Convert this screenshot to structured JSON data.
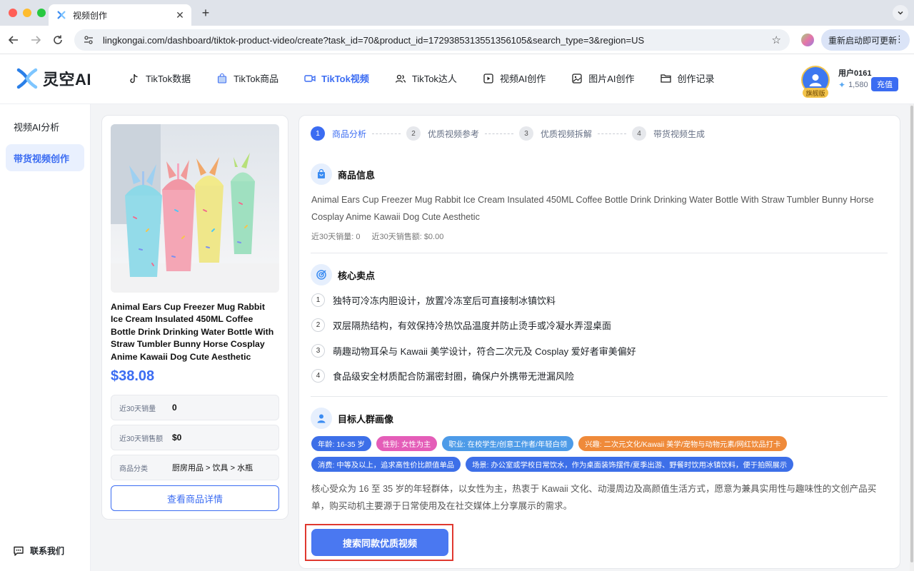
{
  "browser": {
    "tab_title": "视频创作",
    "new_tab": "+",
    "tab_close": "✕",
    "url": "lingkongai.com/dashboard/tiktok-product-video/create?task_id=70&product_id=1729385313551356105&search_type=3&region=US",
    "update_label": "重新启动即可更新",
    "update_menu": "⋮"
  },
  "header": {
    "logo_text": "灵空AI",
    "nav": [
      {
        "label": "TikTok数据",
        "icon": "tiktok-icon"
      },
      {
        "label": "TikTok商品",
        "icon": "bag-icon"
      },
      {
        "label": "TikTok视频",
        "icon": "video-icon"
      },
      {
        "label": "TikTok达人",
        "icon": "people-icon"
      },
      {
        "label": "视频AI创作",
        "icon": "play-icon"
      },
      {
        "label": "图片AI创作",
        "icon": "image-icon"
      },
      {
        "label": "创作记录",
        "icon": "folder-icon"
      }
    ],
    "user": {
      "name": "用户0161",
      "badge": "旗舰版",
      "credits": "1,580",
      "recharge": "充值"
    },
    "accent": "#3b6cf2"
  },
  "sidebar": {
    "items": [
      {
        "label": "视频AI分析"
      },
      {
        "label": "带货视频创作"
      }
    ],
    "contact": "联系我们"
  },
  "product": {
    "title": "Animal Ears Cup Freezer Mug Rabbit Ice Cream Insulated 450ML Coffee Bottle Drink Drinking Water Bottle With Straw Tumbler Bunny Horse Cosplay Anime Kawaii Dog Cute Aesthetic",
    "price": "$38.08",
    "stats": [
      {
        "key": "近30天销量",
        "value": "0"
      },
      {
        "key": "近30天销售额",
        "value": "$0"
      },
      {
        "key": "商品分类",
        "value": "厨房用品 > 饮具 > 水瓶"
      }
    ],
    "detail_button": "查看商品详情"
  },
  "steps": [
    {
      "num": "1",
      "label": "商品分析"
    },
    {
      "num": "2",
      "label": "优质视频参考"
    },
    {
      "num": "3",
      "label": "优质视频拆解"
    },
    {
      "num": "4",
      "label": "带货视频生成"
    }
  ],
  "info": {
    "heading": "商品信息",
    "text": "Animal Ears Cup Freezer Mug Rabbit Ice Cream Insulated 450ML Coffee Bottle Drink Drinking Water Bottle With Straw Tumbler Bunny Horse Cosplay Anime Kawaii Dog Cute Aesthetic",
    "sales_30d": "近30天销量: 0",
    "revenue_30d": "近30天销售额: $0.00"
  },
  "selling_points": {
    "heading": "核心卖点",
    "items": [
      {
        "num": "1",
        "text": "独特可冷冻内胆设计，放置冷冻室后可直接制冰镇饮料"
      },
      {
        "num": "2",
        "text": "双层隔热结构，有效保持冷热饮品温度并防止烫手或冷凝水弄湿桌面"
      },
      {
        "num": "3",
        "text": "萌趣动物耳朵与 Kawaii 美学设计，符合二次元及 Cosplay 爱好者审美偏好"
      },
      {
        "num": "4",
        "text": "食品级安全材质配合防漏密封圈，确保户外携带无泄漏风险"
      }
    ]
  },
  "audience": {
    "heading": "目标人群画像",
    "tags": [
      {
        "text": "年龄: 16-35 岁",
        "color": "#3d6fe8"
      },
      {
        "text": "性别: 女性为主",
        "color": "#e45db8"
      },
      {
        "text": "职业: 在校学生/创意工作者/年轻白领",
        "color": "#4d9be8"
      },
      {
        "text": "兴趣: 二次元文化/Kawaii 美学/宠物与动物元素/网红饮品打卡",
        "color": "#ef8a3a"
      },
      {
        "text": "消费: 中等及以上，追求高性价比颜值单品",
        "color": "#3d6fe8"
      },
      {
        "text": "场景: 办公室或学校日常饮水，作为桌面装饰摆件/夏季出游、野餐时饮用冰镇饮料，便于拍照展示",
        "color": "#3d6fe8"
      }
    ],
    "summary": "核心受众为 16 至 35 岁的年轻群体，以女性为主，热衷于 Kawaii 文化、动漫周边及高颜值生活方式，愿意为兼具实用性与趣味性的文创产品买单，购买动机主要源于日常使用及在社交媒体上分享展示的需求。"
  },
  "search_button": "搜索同款优质视频"
}
